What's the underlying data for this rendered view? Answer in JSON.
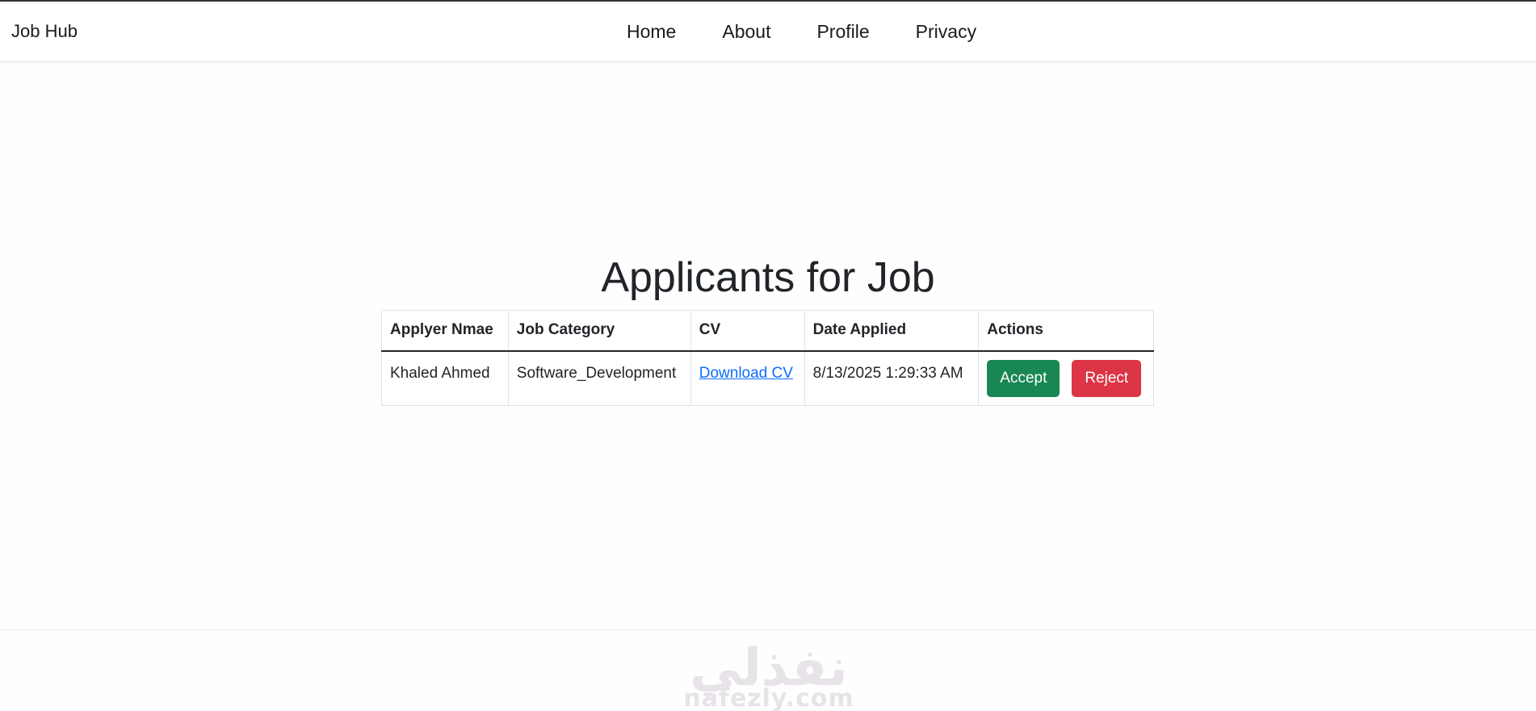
{
  "navbar": {
    "brand": "Job Hub",
    "links": [
      "Home",
      "About",
      "Profile",
      "Privacy"
    ]
  },
  "main": {
    "title": "Applicants for Job",
    "table": {
      "headers": [
        "Applyer Nmae",
        "Job Category",
        "CV",
        "Date Applied",
        "Actions"
      ],
      "rows": [
        {
          "name": "Khaled Ahmed",
          "category": "Software_Development",
          "cv_link": "Download CV",
          "date": "8/13/2025 1:29:33 AM",
          "accept_label": "Accept",
          "reject_label": "Reject"
        }
      ]
    }
  },
  "watermark": {
    "arabic": "نفذلي",
    "latin": "nafezly.com"
  },
  "colors": {
    "accept": "#198754",
    "reject": "#dc3545",
    "link": "#0d6efd"
  }
}
